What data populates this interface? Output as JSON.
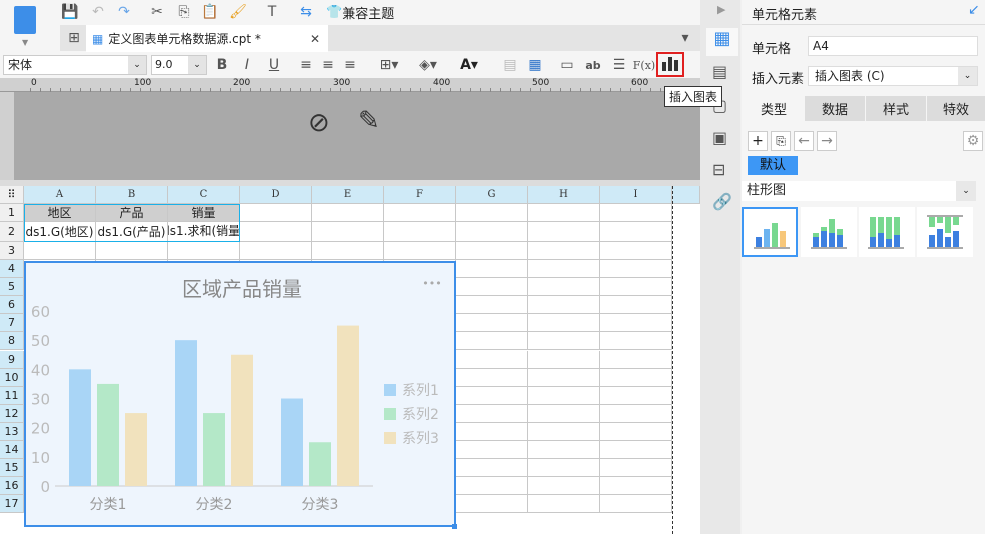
{
  "toolbar": {
    "theme_label": "兼容主题"
  },
  "tab": {
    "title": "定义图表单元格数据源.cpt *"
  },
  "format": {
    "font": "宋体",
    "size": "9.0",
    "bold": "B",
    "italic": "I",
    "underline": "U",
    "ab": "ab",
    "fx": "F(x)"
  },
  "tooltip": "插入图表",
  "ruler": [
    "0",
    "100",
    "200",
    "300",
    "400",
    "500",
    "600"
  ],
  "sheet": {
    "columns": [
      "A",
      "B",
      "C",
      "D",
      "E",
      "F",
      "G",
      "H",
      "I"
    ],
    "rows": [
      "1",
      "2",
      "3",
      "4",
      "5",
      "6",
      "7",
      "8",
      "9",
      "10",
      "11",
      "12",
      "13",
      "14",
      "15",
      "16",
      "17"
    ],
    "r1": [
      "地区",
      "产品",
      "销量"
    ],
    "r2": [
      "ds1.G(地区)",
      "ds1.G(产品)",
      "ds1.求和(销量)"
    ]
  },
  "chart_data": {
    "type": "bar",
    "title": "区域产品销量",
    "categories": [
      "分类1",
      "分类2",
      "分类3"
    ],
    "series": [
      {
        "name": "系列1",
        "values": [
          40,
          50,
          30
        ],
        "color": "#a9d5f6"
      },
      {
        "name": "系列2",
        "values": [
          35,
          25,
          15
        ],
        "color": "#b4e8c8"
      },
      {
        "name": "系列3",
        "values": [
          25,
          45,
          55
        ],
        "color": "#f1e2bd"
      }
    ],
    "yticks": [
      "0",
      "10",
      "20",
      "30",
      "40",
      "50",
      "60"
    ],
    "ylim": [
      0,
      60
    ],
    "legend": "right",
    "more": "•••"
  },
  "panel": {
    "title": "单元格元素",
    "cell_label": "单元格",
    "cell_value": "A4",
    "insert_label": "插入元素",
    "insert_value": "插入图表 (C)",
    "tabs": [
      "类型",
      "数据",
      "样式",
      "特效"
    ],
    "default_label": "默认",
    "chart_kind": "柱形图"
  }
}
